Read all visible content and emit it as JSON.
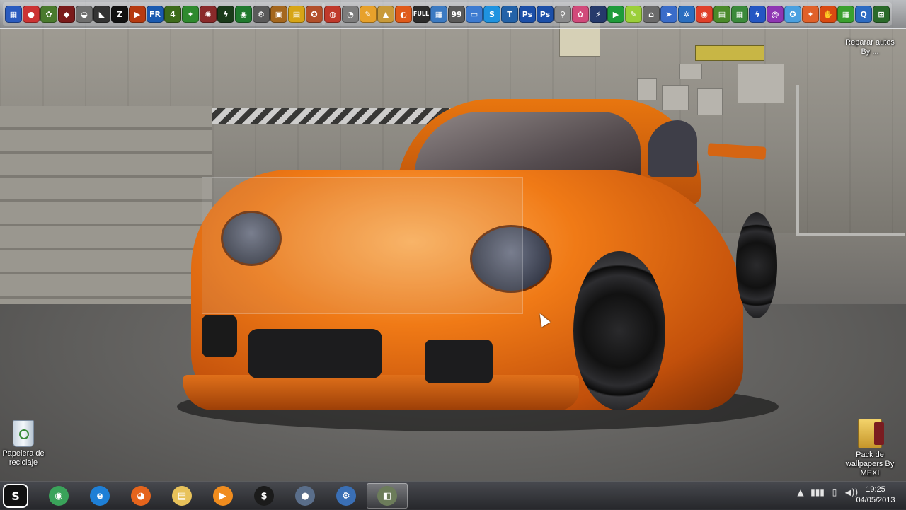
{
  "desktop": {
    "icons": [
      {
        "label": "Papelera de reciclaje",
        "icon": "recycle-bin-icon"
      },
      {
        "label": "Pack de wallpapers By MEXI",
        "icon": "folder-icon"
      },
      {
        "label": "Reparar autos By ...",
        "icon": "shortcut-icon"
      }
    ]
  },
  "topbar": {
    "left_icons": [
      {
        "name": "app-1",
        "color": "#2a5bbf",
        "glyph": "▦"
      },
      {
        "name": "app-2",
        "color": "#c33",
        "glyph": "●"
      },
      {
        "name": "app-3",
        "color": "#497a2d",
        "glyph": "✿"
      },
      {
        "name": "app-4",
        "color": "#7a1a1a",
        "glyph": "◆"
      },
      {
        "name": "app-5",
        "color": "#6f6f6f",
        "glyph": "◒"
      },
      {
        "name": "app-6",
        "color": "#333",
        "glyph": "◣"
      },
      {
        "name": "app-7",
        "color": "#111",
        "glyph": "Z"
      },
      {
        "name": "app-8",
        "color": "#b63a10",
        "glyph": "▶"
      },
      {
        "name": "app-9",
        "color": "#1a5ab0",
        "glyph": "FR"
      },
      {
        "name": "app-10",
        "color": "#3d6b1b",
        "glyph": "4"
      },
      {
        "name": "app-11",
        "color": "#2e8a2e",
        "glyph": "✦"
      },
      {
        "name": "app-12",
        "color": "#8a2a2a",
        "glyph": "✺"
      },
      {
        "name": "app-13",
        "color": "#1a3a1a",
        "glyph": "ϟ"
      },
      {
        "name": "app-14",
        "color": "#1f7a2e",
        "glyph": "◉"
      },
      {
        "name": "app-15",
        "color": "#5a5a5a",
        "glyph": "⚙"
      },
      {
        "name": "app-16",
        "color": "#a4671e",
        "glyph": "▣"
      },
      {
        "name": "app-17",
        "color": "#d7a516",
        "glyph": "▤"
      },
      {
        "name": "app-18",
        "color": "#b24f2a",
        "glyph": "✪"
      }
    ],
    "right_icons": [
      {
        "name": "app-r1",
        "color": "#c0392b",
        "glyph": "◍"
      },
      {
        "name": "app-r2",
        "color": "#7d7d7d",
        "glyph": "◔"
      },
      {
        "name": "app-r3",
        "color": "#e7a12b",
        "glyph": "✎"
      },
      {
        "name": "app-r4",
        "color": "#c89a3a",
        "glyph": "▲"
      },
      {
        "name": "app-r5",
        "color": "#e05a1a",
        "glyph": "◐"
      },
      {
        "name": "app-r6",
        "color": "#2b2b2b",
        "glyph": "FULL"
      },
      {
        "name": "app-r7",
        "color": "#3b7ac2",
        "glyph": "▦"
      },
      {
        "name": "app-r8",
        "color": "#5a5a5a",
        "glyph": "99"
      },
      {
        "name": "app-r9",
        "color": "#3d7bd1",
        "glyph": "▭"
      },
      {
        "name": "app-r10",
        "color": "#1f93e0",
        "glyph": "S"
      },
      {
        "name": "app-r11",
        "color": "#2362a8",
        "glyph": "T"
      },
      {
        "name": "app-r12",
        "color": "#1c4fa8",
        "glyph": "Ps"
      },
      {
        "name": "app-r13",
        "color": "#1c4fa8",
        "glyph": "Ps"
      },
      {
        "name": "app-r14",
        "color": "#8b8b8b",
        "glyph": "⚲"
      },
      {
        "name": "app-r15",
        "color": "#d14a7a",
        "glyph": "✿"
      },
      {
        "name": "app-r16",
        "color": "#263a6b",
        "glyph": "⚡"
      },
      {
        "name": "app-r17",
        "color": "#1f9b3a",
        "glyph": "▶"
      },
      {
        "name": "app-r18",
        "color": "#9bcf3a",
        "glyph": "✎"
      },
      {
        "name": "app-r19",
        "color": "#6a6a6a",
        "glyph": "⌂"
      },
      {
        "name": "app-r20",
        "color": "#3a6cc9",
        "glyph": "➤"
      },
      {
        "name": "app-r21",
        "color": "#2a6ec0",
        "glyph": "✲"
      },
      {
        "name": "app-r22",
        "color": "#e0402a",
        "glyph": "◉"
      },
      {
        "name": "app-r23",
        "color": "#4a8a2a",
        "glyph": "▤"
      },
      {
        "name": "app-r24",
        "color": "#3b8a3b",
        "glyph": "▦"
      },
      {
        "name": "app-r25",
        "color": "#2456c3",
        "glyph": "ϟ"
      },
      {
        "name": "app-r26",
        "color": "#8e35b3",
        "glyph": "@"
      },
      {
        "name": "app-r27",
        "color": "#4aa0e0",
        "glyph": "✪"
      },
      {
        "name": "app-r28",
        "color": "#e0612a",
        "glyph": "✦"
      },
      {
        "name": "app-r29",
        "color": "#d94a12",
        "glyph": "✋"
      },
      {
        "name": "app-r30",
        "color": "#3aa02e",
        "glyph": "▦"
      },
      {
        "name": "app-r31",
        "color": "#2c6bc2",
        "glyph": "Q"
      },
      {
        "name": "app-r32",
        "color": "#2a6a2a",
        "glyph": "⊞"
      }
    ]
  },
  "taskbar": {
    "start_label": "S",
    "items": [
      {
        "name": "chrome",
        "color": "#3aa35a",
        "glyph": "◉",
        "active": false
      },
      {
        "name": "internet-explorer",
        "color": "#1e7fd6",
        "glyph": "e",
        "active": false
      },
      {
        "name": "firefox",
        "color": "#e5641c",
        "glyph": "◕",
        "active": false
      },
      {
        "name": "file-explorer",
        "color": "#e8c25a",
        "glyph": "▤",
        "active": false
      },
      {
        "name": "media-player",
        "color": "#f08c1e",
        "glyph": "▶",
        "active": false
      },
      {
        "name": "app-s",
        "color": "#1b1b1b",
        "glyph": "$",
        "active": false
      },
      {
        "name": "app-orb",
        "color": "#5a6e8a",
        "glyph": "●",
        "active": false
      },
      {
        "name": "app-gear",
        "color": "#3a6fb5",
        "glyph": "⚙",
        "active": false
      },
      {
        "name": "app-window",
        "color": "#6c7c5a",
        "glyph": "◧",
        "active": true
      }
    ],
    "tray_icons": [
      "▲",
      "▮▮▮",
      "▯",
      "◀))"
    ],
    "time": "19:25",
    "date": "04/05/2013"
  }
}
